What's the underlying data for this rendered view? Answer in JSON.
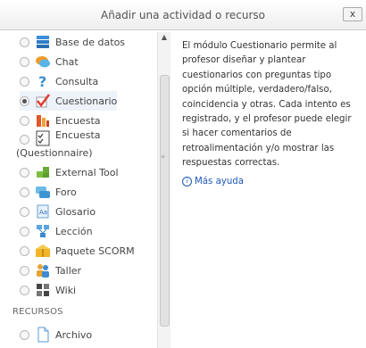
{
  "dialog": {
    "title": "Añadir una actividad o recurso",
    "close_label": "x"
  },
  "options": [
    {
      "label": "Base de datos",
      "icon": "database-icon"
    },
    {
      "label": "Chat",
      "icon": "chat-bubble-icon"
    },
    {
      "label": "Consulta",
      "icon": "question-mark-icon"
    },
    {
      "label": "Cuestionario",
      "icon": "checkmark-icon"
    },
    {
      "label": "Encuesta",
      "icon": "survey-flag-icon"
    },
    {
      "label_line1": "Encuesta",
      "label_line2": "(Questionnaire)",
      "icon": "questionnaire-checklist-icon"
    },
    {
      "label": "External Tool",
      "icon": "puzzle-piece-icon"
    },
    {
      "label": "Foro",
      "icon": "forum-icon"
    },
    {
      "label": "Glosario",
      "icon": "glossary-book-icon"
    },
    {
      "label": "Lección",
      "icon": "lesson-flow-icon"
    },
    {
      "label": "Paquete SCORM",
      "icon": "scorm-package-icon"
    },
    {
      "label": "Taller",
      "icon": "workshop-people-icon"
    },
    {
      "label": "Wiki",
      "icon": "wiki-icon"
    }
  ],
  "resources_header": "RECURSOS",
  "resources": [
    {
      "label": "Archivo",
      "icon": "file-icon"
    }
  ],
  "selected_option": "Cuestionario",
  "description": "El módulo Cuestionario permite al profesor diseñar y plantear cuestionarios con preguntas tipo opción múltiple, verdadero/falso, coincidencia y otras. Cada intento es registrado, y el profesor puede elegir si hacer comentarios de retroalimentación y/o mostrar las respuestas correctas.",
  "help_link": "Más ayuda",
  "colors": {
    "link": "#1f57b8",
    "selected_bg": "#eef3fa"
  }
}
